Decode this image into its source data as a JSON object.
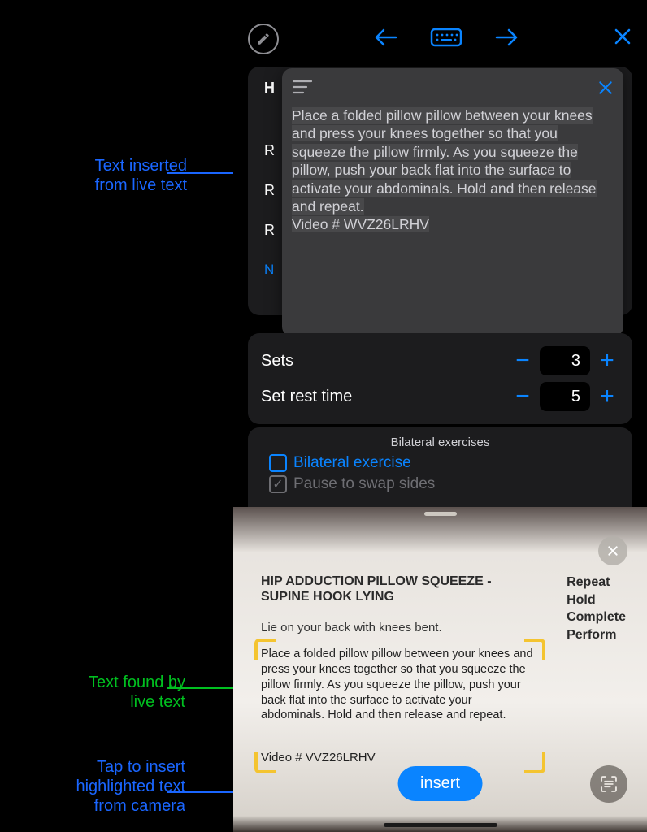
{
  "annotations": {
    "inserted": "Text inserted\nfrom live text",
    "found": "Text found by\nlive text",
    "tap": "Tap to insert\nhighlighted text\nfrom camera"
  },
  "bg": {
    "h": "H",
    "r1": "R",
    "dash1": "-",
    "r2": "R",
    "dash2": "-",
    "r3": "R",
    "dash3": "-",
    "new": "N"
  },
  "popup": {
    "body": "Place a folded pillow pillow between your knees and press your knees together so that you squeeze the pillow firmly. As you squeeze the pillow, push your back flat into the surface to activate your abdominals. Hold and then release and repeat.",
    "video": "Video # WVZ26LRHV"
  },
  "stepper": {
    "sets_label": "Sets",
    "sets_value": "3",
    "rest_label": "Set rest time",
    "rest_value": "5"
  },
  "bilat": {
    "title": "Bilateral exercises",
    "opt1": "Bilateral exercise",
    "opt2": "Pause to swap sides"
  },
  "camera": {
    "title": "HIP ADDUCTION PILLOW SQUEEZE - SUPINE HOOK LYING",
    "sub": "Lie on your back with knees bent.",
    "body": "Place a folded pillow pillow between your knees and press your knees together so that you squeeze the pillow firmly. As you squeeze the pillow, push your back flat into the surface to activate your abdominals. Hold and then release and repeat.",
    "video": "Video # VVZ26LRHV",
    "right1": "Repeat",
    "right2": "Hold",
    "right3": "Complete",
    "right4": "Perform",
    "insert": "insert"
  }
}
